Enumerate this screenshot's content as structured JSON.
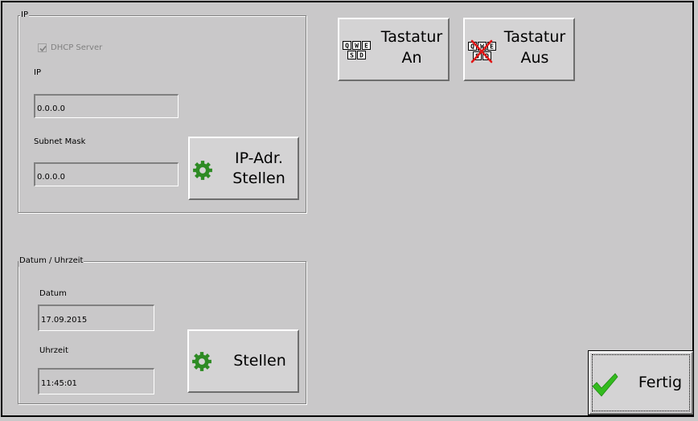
{
  "ip_group": {
    "legend": "IP",
    "dhcp_label": "DHCP Server",
    "dhcp_checked": true,
    "ip_label": "IP",
    "ip_value": "0.0.0.0",
    "subnet_label": "Subnet Mask",
    "subnet_value": "0.0.0.0",
    "set_ip_button": {
      "line1": "IP-Adr.",
      "line2": "Stellen",
      "icon": "gear-icon"
    }
  },
  "datetime_group": {
    "legend": "Datum / Uhrzeit",
    "date_label": "Datum",
    "date_value": "17.09.2015",
    "time_label": "Uhrzeit",
    "time_value": "11:45:01",
    "set_button": {
      "label": "Stellen",
      "icon": "gear-icon"
    }
  },
  "keyboard_on_button": {
    "line1": "Tastatur",
    "line2": "An",
    "icon": "keyboard-icon"
  },
  "keyboard_off_button": {
    "line1": "Tastatur",
    "line2": "Aus",
    "icon": "keyboard-off-icon"
  },
  "done_button": {
    "label": "Fertig",
    "icon": "checkmark-icon"
  },
  "colors": {
    "background": "#c9c8c9",
    "gear": "#2e8b24",
    "check": "#33bb1e",
    "cross": "#e01818"
  },
  "key_letters": {
    "top": [
      "Q",
      "W",
      "E"
    ],
    "bottom": [
      "S",
      "D"
    ]
  }
}
